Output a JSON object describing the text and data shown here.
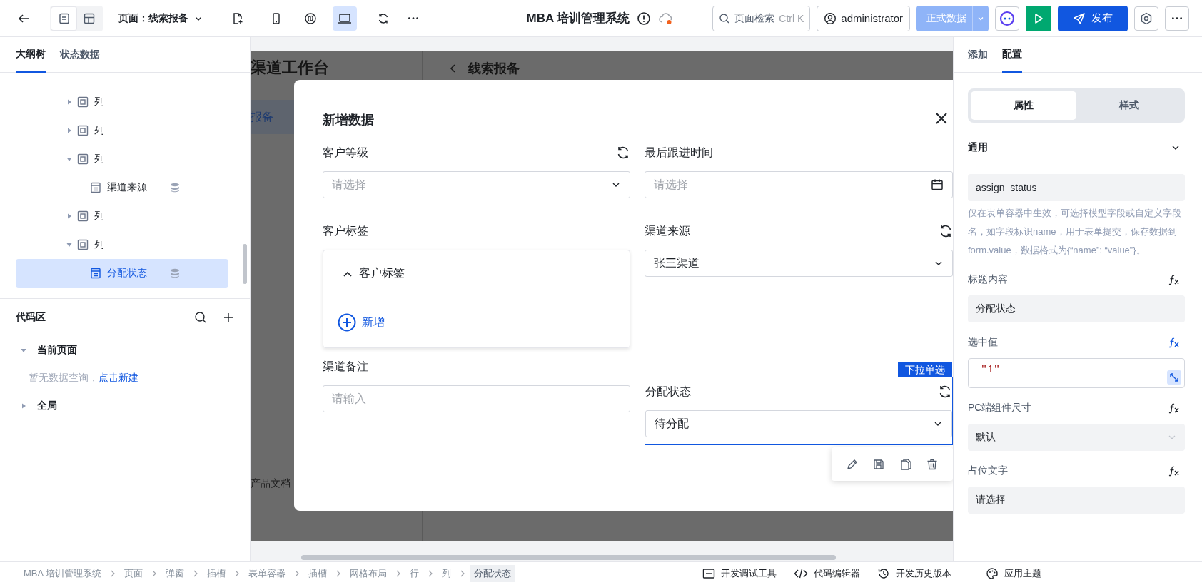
{
  "topbar": {
    "view_toggles": [
      {
        "selected": true
      },
      {
        "selected": false
      }
    ],
    "page_selector": "页面：线索报备",
    "devices": [
      {
        "selected": false
      },
      {
        "selected": false
      },
      {
        "selected": true
      }
    ],
    "app_title": "MBA 培训管理系统",
    "search": {
      "label": "页面检索",
      "shortcut": "Ctrl K"
    },
    "user": "administrator",
    "env": "正式数据",
    "publish": "发布"
  },
  "left_panel": {
    "tabs": [
      {
        "label": "大纲树",
        "selected": true
      },
      {
        "label": "状态数据",
        "selected": false
      }
    ],
    "tree": [
      {
        "kind": "column",
        "label": "列",
        "expanded": false,
        "selected": false
      },
      {
        "kind": "column",
        "label": "列",
        "expanded": false,
        "selected": false
      },
      {
        "kind": "column",
        "label": "列",
        "expanded": true,
        "selected": false,
        "children": [
          {
            "kind": "field",
            "label": "渠道来源",
            "selected": false
          }
        ]
      },
      {
        "kind": "column",
        "label": "列",
        "expanded": false,
        "selected": false
      },
      {
        "kind": "column",
        "label": "列",
        "expanded": true,
        "selected": false,
        "children": [
          {
            "kind": "field",
            "label": "分配状态",
            "selected": true
          }
        ]
      }
    ],
    "code_area": {
      "title": "代码区",
      "sections": [
        {
          "label": "当前页面",
          "expanded": true,
          "empty_text": "暂无数据查询，",
          "link": "点击新建"
        },
        {
          "label": "全局",
          "expanded": false
        }
      ]
    }
  },
  "canvas": {
    "page_title": "渠道工作台",
    "menu_item": "报备",
    "footer_item": "产品文档",
    "header": "线索报备"
  },
  "dialog": {
    "title": "新增数据",
    "fields": [
      {
        "kind": "select",
        "label": "客户等级",
        "refresh": true,
        "placeholder": "请选择",
        "selected": false
      },
      {
        "kind": "date",
        "label": "最后跟进时间",
        "refresh": false,
        "placeholder": "请选择",
        "selected": false
      },
      {
        "kind": "group",
        "label": "客户标签",
        "refresh": false,
        "group_title": "客户标签",
        "expanded": true,
        "add_label": "新增",
        "selected": false
      },
      {
        "kind": "select",
        "label": "渠道来源",
        "refresh": true,
        "value": "张三渠道",
        "selected": false
      },
      {
        "kind": "input",
        "label": "渠道备注",
        "refresh": false,
        "placeholder": "请输入",
        "selected": false
      },
      {
        "kind": "select",
        "label": "分配状态",
        "refresh": true,
        "value": "待分配",
        "selected": true,
        "badge": "下拉单选"
      }
    ]
  },
  "right_panel": {
    "tabs": [
      {
        "label": "添加",
        "selected": false
      },
      {
        "label": "配置",
        "selected": true
      }
    ],
    "segments": [
      {
        "label": "属性",
        "selected": true
      },
      {
        "label": "样式",
        "selected": false
      }
    ],
    "section": {
      "title": "通用",
      "expanded": true
    },
    "field_name": "assign_status",
    "help": "仅在表单容器中生效，可选择模型字段或自定义字段名，如字段标识name，用于表单提交，保存数据到form.value，数据格式为{“name”: “value”}。",
    "props": [
      {
        "kind": "text",
        "label": "标题内容",
        "value": "分配状态",
        "fx_active": false
      },
      {
        "kind": "code",
        "label": "选中值",
        "value": "\"1\"",
        "fx_active": true
      },
      {
        "kind": "select",
        "label": "PC端组件尺寸",
        "value": "默认",
        "fx_active": false
      },
      {
        "kind": "text",
        "label": "占位文字",
        "value": "请选择",
        "fx_active": false
      }
    ]
  },
  "status_bar": {
    "breadcrumbs": [
      {
        "label": "MBA 培训管理系统",
        "selected": false
      },
      {
        "label": "页面",
        "selected": false
      },
      {
        "label": "弹窗",
        "selected": false
      },
      {
        "label": "插槽",
        "selected": false
      },
      {
        "label": "表单容器",
        "selected": false
      },
      {
        "label": "插槽",
        "selected": false
      },
      {
        "label": "网格布局",
        "selected": false
      },
      {
        "label": "行",
        "selected": false
      },
      {
        "label": "列",
        "selected": false
      },
      {
        "label": "分配状态",
        "selected": true
      }
    ],
    "tools": [
      {
        "kind": "debug",
        "label": "开发调试工具"
      },
      {
        "kind": "code",
        "label": "代码编辑器"
      },
      {
        "kind": "history",
        "label": "开发历史版本"
      }
    ],
    "theme": "应用主题"
  }
}
